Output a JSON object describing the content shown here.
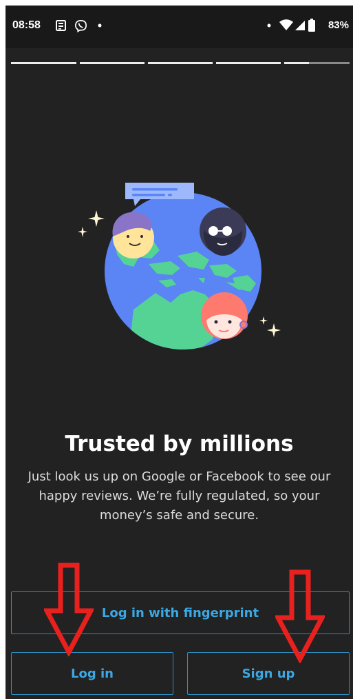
{
  "status_bar": {
    "time": "08:58",
    "battery": "83%",
    "icons": [
      "news-icon",
      "viber-icon",
      "dot-icon",
      "wifi-icon",
      "signal-icon",
      "battery-icon"
    ]
  },
  "onboarding": {
    "progress_steps": 5,
    "current_step": 5,
    "headline": "Trusted by millions",
    "body": "Just look us up on Google or Facebook to see our happy reviews. We’re fully regulated, so your money’s safe and secure."
  },
  "buttons": {
    "fingerprint": "Log in with fingerprint",
    "login": "Log in",
    "signup": "Sign up"
  },
  "colors": {
    "background": "#222222",
    "accent": "#3ba8e3",
    "annotation_arrow": "#e8211f"
  }
}
